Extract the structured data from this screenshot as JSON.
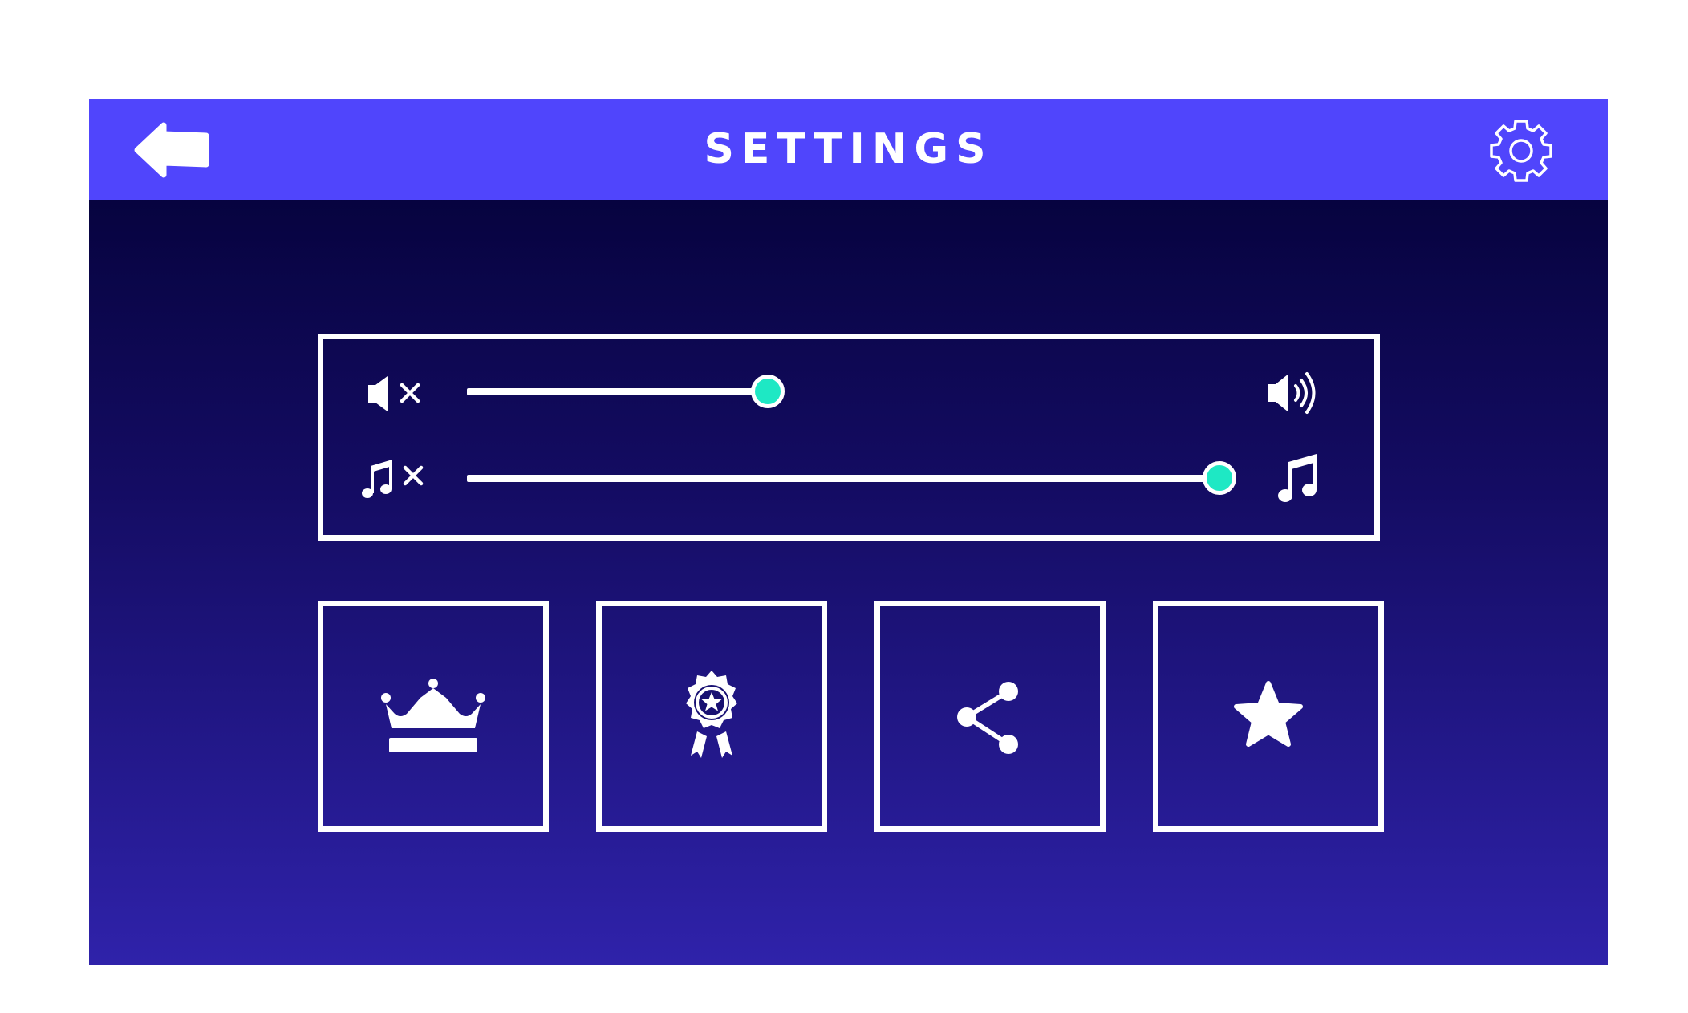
{
  "header": {
    "title": "SETTINGS",
    "back_icon": "back-arrow-icon",
    "settings_icon": "gear-icon"
  },
  "audio": {
    "sound": {
      "min_icon": "volume-mute-icon",
      "max_icon": "volume-high-icon",
      "level": 0.4
    },
    "music": {
      "min_icon": "music-mute-icon",
      "max_icon": "music-icon",
      "level": 1.0
    }
  },
  "tiles": [
    {
      "icon": "crown-icon"
    },
    {
      "icon": "award-badge-icon"
    },
    {
      "icon": "share-icon"
    },
    {
      "icon": "star-icon"
    }
  ],
  "colors": {
    "header": "#5045fc",
    "background_top": "#020033",
    "background_bottom": "#2f22aa",
    "slider_knob": "#1ee8c4",
    "foreground": "#ffffff"
  }
}
